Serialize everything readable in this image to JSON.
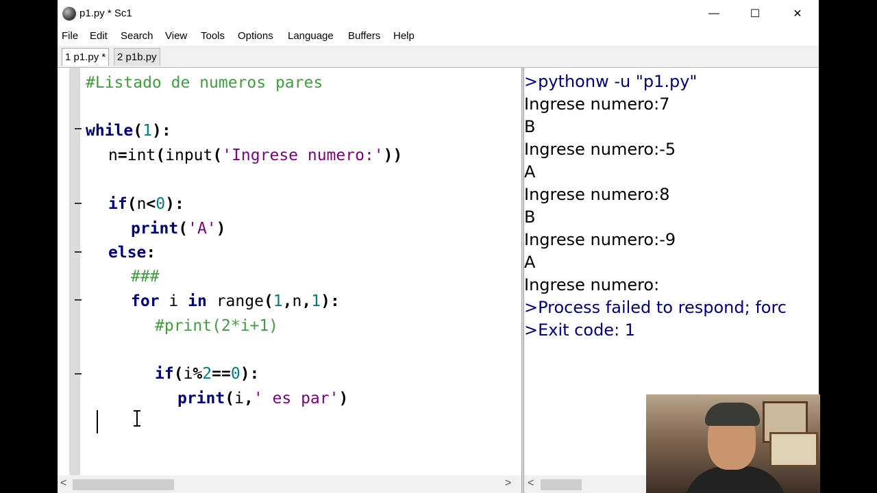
{
  "window": {
    "title": "p1.py * Sc1",
    "controls": {
      "minimize": "—",
      "maximize": "☐",
      "close": "✕"
    }
  },
  "menu": [
    "File",
    "Edit",
    "Search",
    "View",
    "Tools",
    "Options",
    "Language",
    "Buffers",
    "Help"
  ],
  "tabs": [
    {
      "label": "1 p1.py *",
      "active": true
    },
    {
      "label": "2 p1b.py",
      "active": false
    }
  ],
  "editor": {
    "lines": [
      "#Listado de numeros pares",
      "",
      "while(1):",
      "  n=int(input('Ingrese numero:'))",
      "",
      "  if(n<0):",
      "    print('A')",
      "  else:",
      "    ###",
      "    for i in range(1,n,1):",
      "      #print(2*i+1)",
      "",
      "      if(i%2==0):",
      "        print(i,' es par')",
      ""
    ]
  },
  "output": {
    "lines": [
      ">pythonw -u \"p1.py\"",
      "Ingrese numero:7",
      "B",
      "Ingrese numero:-5",
      "A",
      "Ingrese numero:8",
      "B",
      "Ingrese numero:-9",
      "A",
      "Ingrese numero:",
      ">Process failed to respond; forc",
      ">Exit code: 1"
    ]
  },
  "scroll": {
    "left_arrow": "<",
    "right_arrow": ">"
  },
  "colors": {
    "keyword": "#00007f",
    "string": "#7f007f",
    "number": "#007f7f",
    "comment": "#3f9f3f",
    "system_output": "#00007f"
  }
}
